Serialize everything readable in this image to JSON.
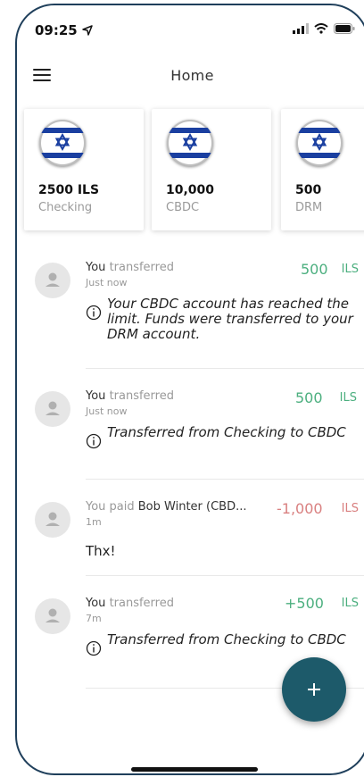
{
  "status_bar": {
    "time": "09:25"
  },
  "header": {
    "title": "Home"
  },
  "accounts": [
    {
      "amount": "2500 ILS",
      "label": "Checking",
      "flag": "israel-flag"
    },
    {
      "amount": "10,000",
      "label": "CBDC",
      "flag": "israel-flag"
    },
    {
      "amount": "500",
      "label": "DRM",
      "flag": "israel-flag"
    }
  ],
  "feed": [
    {
      "who": "You",
      "action": "transferred",
      "time": "Just now",
      "amount": "500",
      "currency": "ILS",
      "note": "Your CBDC account has reached the limit. Funds were transferred to your DRM account."
    },
    {
      "who": "You",
      "action": "transferred",
      "time": "Just now",
      "amount": "500",
      "currency": "ILS",
      "note": "Transferred from Checking to CBDC"
    },
    {
      "who": "Bob Winter (CBD...",
      "action": "You paid",
      "time": "1m",
      "amount": "-1,000",
      "currency": "ILS",
      "note": "Thx!"
    },
    {
      "who": "You",
      "action": "transferred",
      "time": "7m",
      "amount": "+500",
      "currency": "ILS",
      "note": "Transferred from Checking to CBDC"
    }
  ],
  "colors": {
    "accent": "#1d5a6a",
    "positive": "#4caf7f",
    "negative": "#d98080",
    "frame": "#1f3f5b"
  },
  "fab": {
    "icon": "plus-icon"
  }
}
